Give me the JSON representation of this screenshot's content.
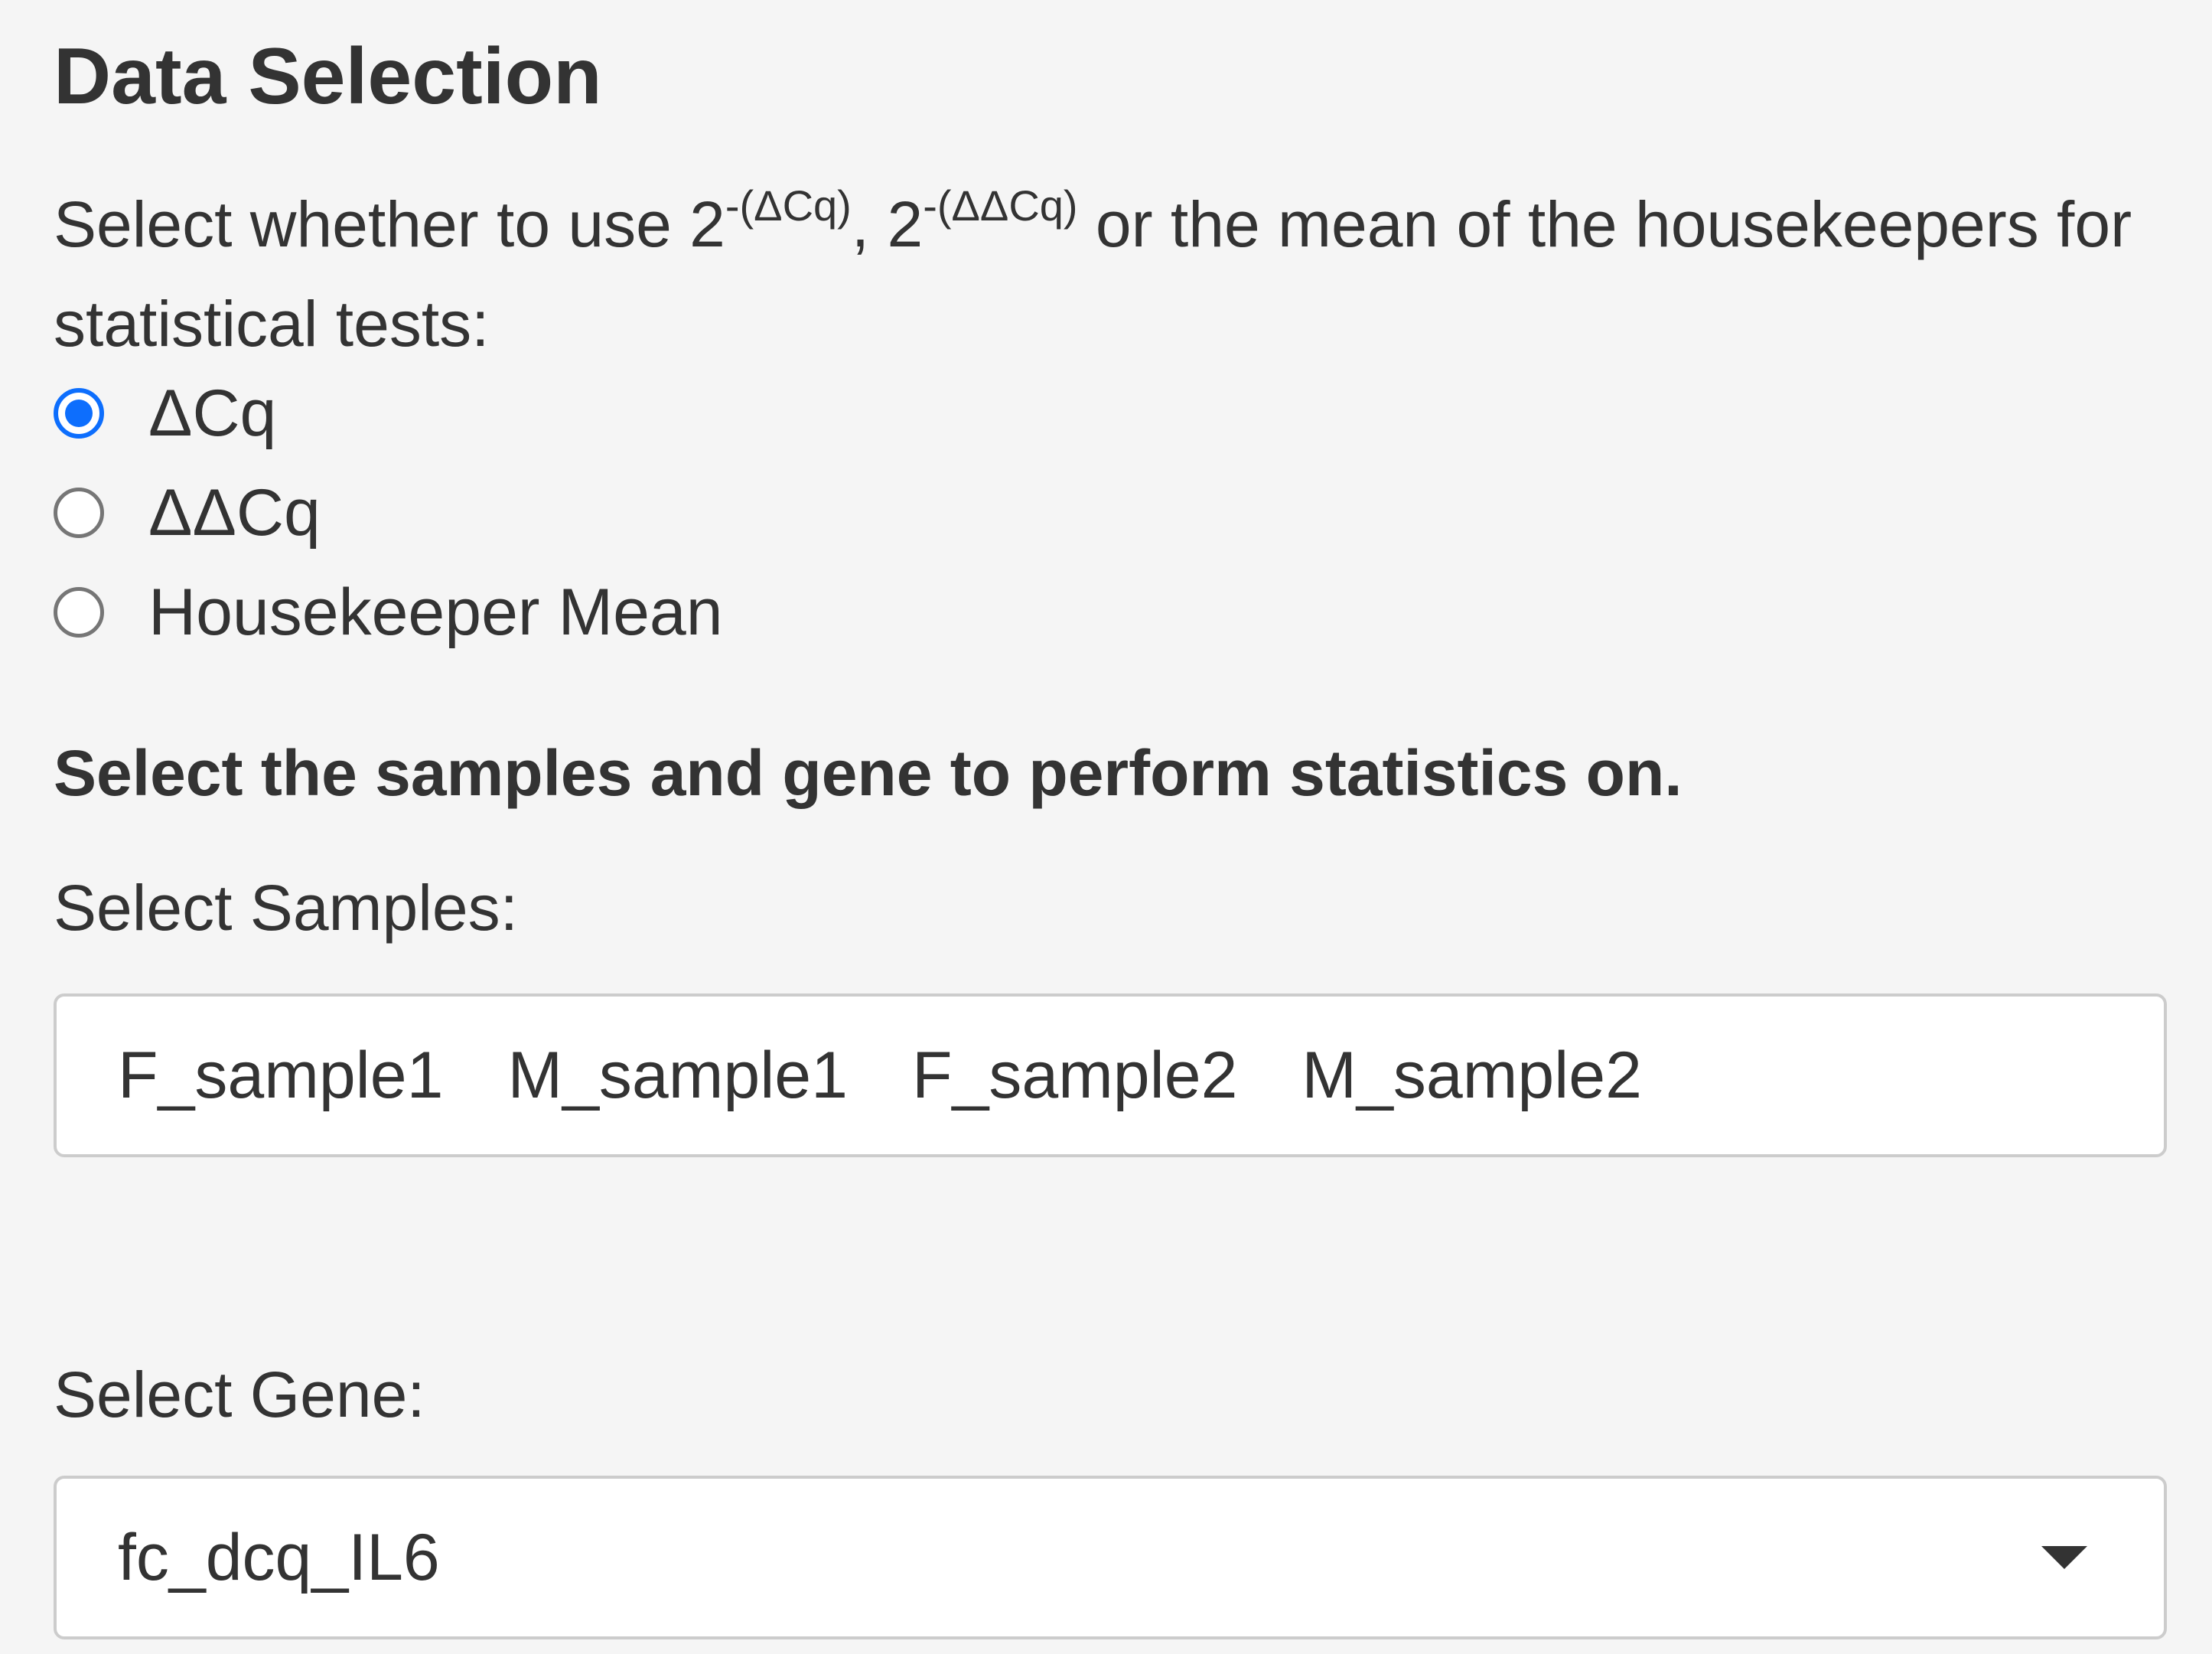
{
  "section": {
    "title": "Data Selection",
    "description_prefix": "Select whether to use 2",
    "dcq_exponent": "-(ΔCq)",
    "separator": ", 2",
    "ddcq_exponent": "-(ΔΔCq)",
    "description_suffix": " or the mean of the housekeepers for statistical tests:"
  },
  "method_options": [
    {
      "label": "ΔCq",
      "selected": true
    },
    {
      "label": "ΔΔCq",
      "selected": false
    },
    {
      "label": "Housekeeper Mean",
      "selected": false
    }
  ],
  "instruction": "Select the samples and gene to perform statistics on.",
  "samples": {
    "label": "Select Samples:",
    "selected": [
      "F_sample1",
      "M_sample1",
      "F_sample2",
      "M_sample2"
    ]
  },
  "gene": {
    "label": "Select Gene:",
    "value": "fc_dcq_IL6",
    "icon": "caret-down-icon"
  },
  "colors": {
    "accent": "#0d6efd",
    "background": "#f5f5f5",
    "text": "#333333"
  }
}
